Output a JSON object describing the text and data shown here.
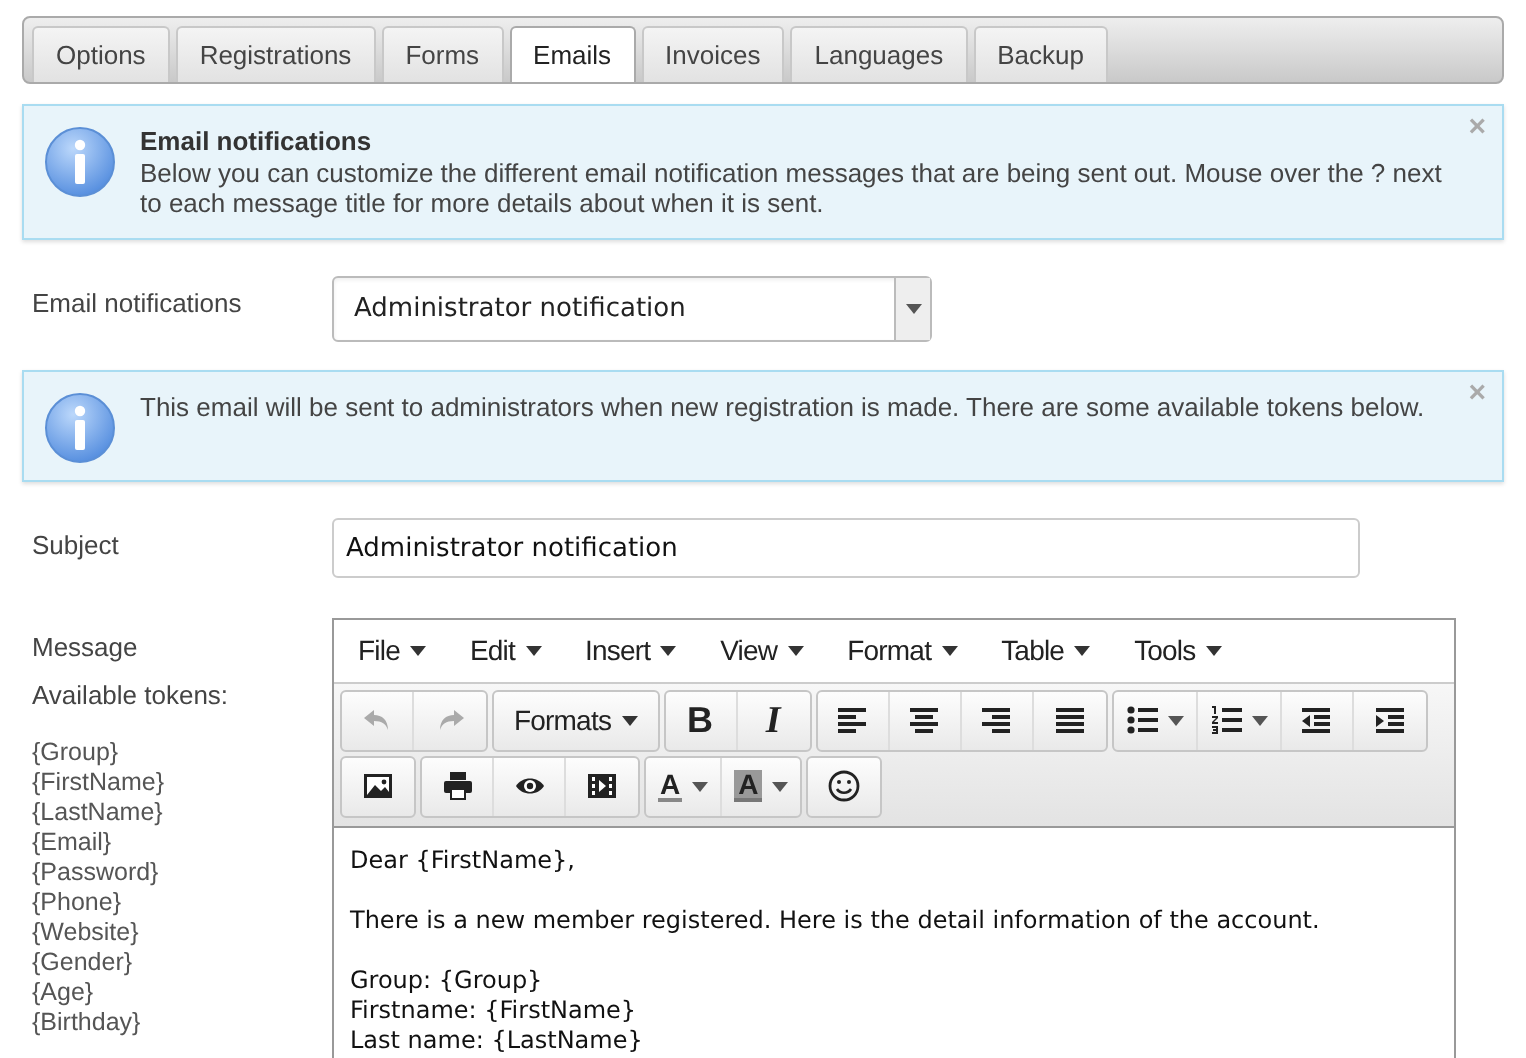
{
  "tabs": [
    {
      "label": "Options",
      "selected": false
    },
    {
      "label": "Registrations",
      "selected": false
    },
    {
      "label": "Forms",
      "selected": false
    },
    {
      "label": "Emails",
      "selected": true
    },
    {
      "label": "Invoices",
      "selected": false
    },
    {
      "label": "Languages",
      "selected": false
    },
    {
      "label": "Backup",
      "selected": false
    }
  ],
  "intro_alert": {
    "title": "Email notifications",
    "text": "Below you can customize the different email notification messages that are being sent out. Mouse over the ? next to each message title for more details about when it is sent.",
    "close": "×"
  },
  "email_notifications": {
    "label": "Email notifications",
    "value": "Administrator notification"
  },
  "info_alert": {
    "text": "This email will be sent to administrators when new registration is made. There are some available tokens below.",
    "close": "×"
  },
  "subject": {
    "label": "Subject",
    "value": "Administrator notification"
  },
  "message": {
    "label": "Message",
    "tokens_label": "Available tokens:",
    "tokens": [
      "{Group}",
      "{FirstName}",
      "{LastName}",
      "{Email}",
      "{Password}",
      "{Phone}",
      "{Website}",
      "{Gender}",
      "{Age}",
      "{Birthday}"
    ]
  },
  "editor": {
    "menu": [
      "File",
      "Edit",
      "Insert",
      "View",
      "Format",
      "Table",
      "Tools"
    ],
    "formats_label": "Formats",
    "glyph_buttons": [
      {
        "kind": "bold",
        "label": "B"
      },
      {
        "kind": "italic",
        "label": "I"
      },
      {
        "kind": "text_color",
        "label": "A"
      },
      {
        "kind": "highlight_color",
        "label": "A"
      }
    ],
    "paragraphs": [
      [
        "Dear {FirstName},"
      ],
      [
        "There is a new member registered. Here is the detail information of the account."
      ],
      [
        "Group: {Group}",
        "Firstname: {FirstName}",
        "Last name: {LastName}"
      ]
    ]
  }
}
